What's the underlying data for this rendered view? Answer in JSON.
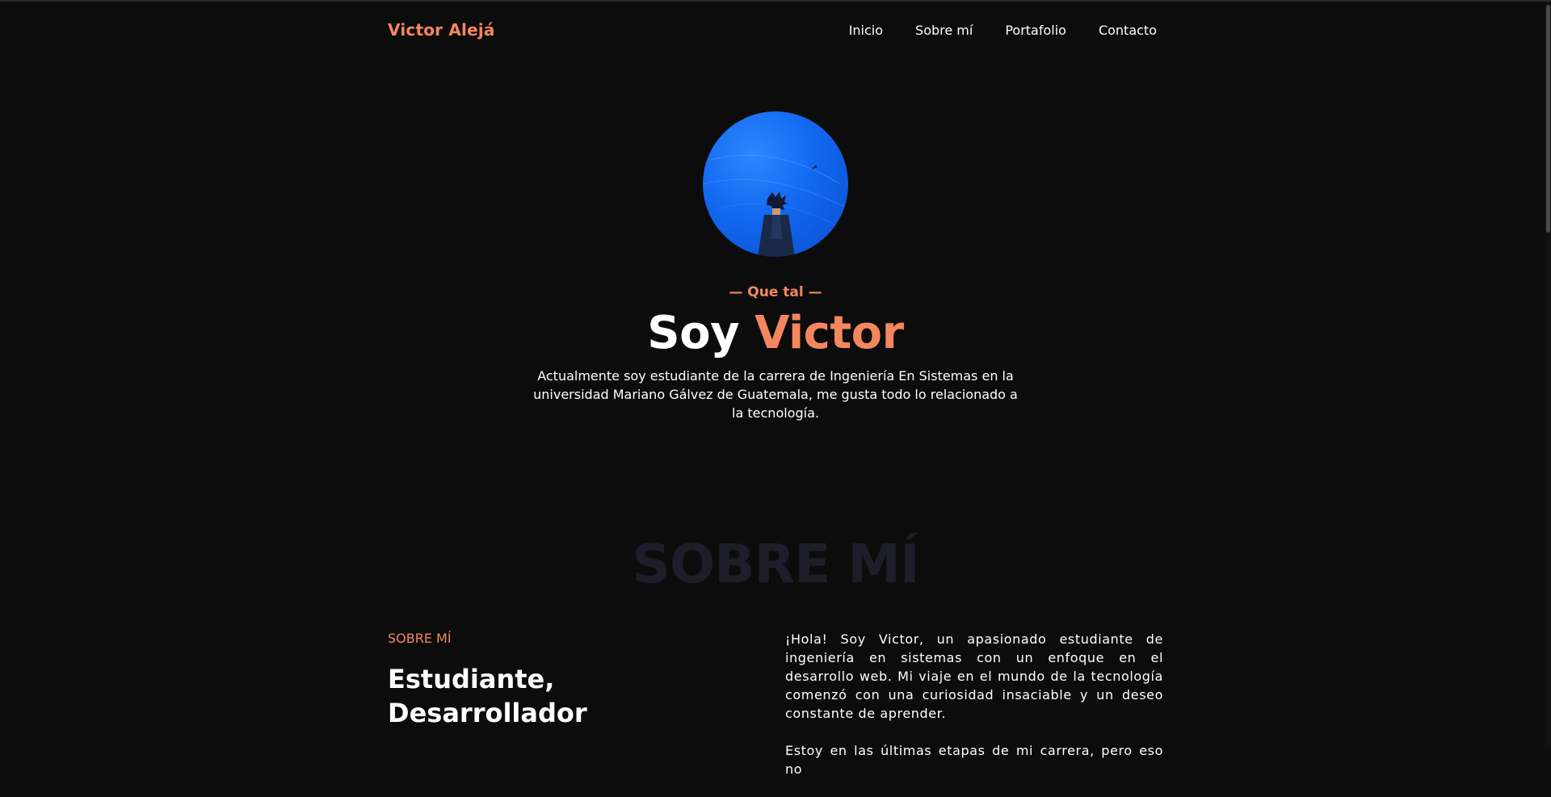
{
  "navbar": {
    "brand": "Victor Alejá",
    "links": [
      "Inicio",
      "Sobre mí",
      "Portafolio",
      "Contacto"
    ]
  },
  "hero": {
    "kicker": "— Que tal —",
    "title_prefix": "Soy",
    "title_name": "Victor",
    "description": "Actualmente soy estudiante de la carrera de Ingeniería En Sistemas en la universidad Mariano Gálvez de Guatemala, me gusta todo lo relacionado a la tecnología."
  },
  "about": {
    "watermark": "SOBRE MÍ",
    "kicker": "SOBRE MÍ",
    "heading_line1": "Estudiante,",
    "heading_line2": "Desarrollador",
    "paragraph1": "¡Hola! Soy Victor, un apasionado estudiante de ingeniería en sistemas con un enfoque en el desarrollo web. Mi viaje en el mundo de la tecnología comenzó con una curiosidad insaciable y un deseo constante de aprender.",
    "paragraph2": "Estoy en las últimas etapas de mi carrera, pero eso no"
  },
  "colors": {
    "accent": "#f4865f",
    "background": "#0c0c0d",
    "watermark": "#1d1e2a",
    "avatar_blue": "#1268f0"
  }
}
